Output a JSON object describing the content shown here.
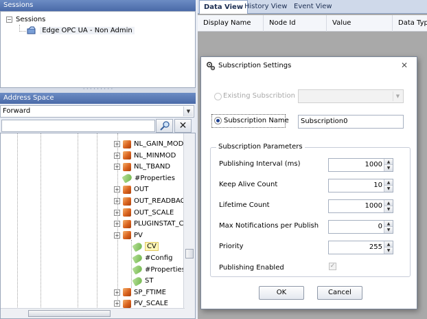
{
  "sessions_pane": {
    "title": "Sessions",
    "root_label": "Sessions",
    "session_label": "Edge OPC UA - Non Admin"
  },
  "address_space": {
    "title": "Address Space",
    "view_mode": "Forward",
    "search_value": "",
    "nodes": [
      {
        "label": "NL_GAIN_MOD",
        "icon": "object-cube-icon",
        "expandable": true,
        "selected": false
      },
      {
        "label": "NL_MINMOD",
        "icon": "object-cube-icon",
        "expandable": true,
        "selected": false
      },
      {
        "label": "NL_TBAND",
        "icon": "object-cube-icon",
        "expandable": true,
        "selected": false
      },
      {
        "label": "#Properties",
        "icon": "property-tag-icon",
        "expandable": false,
        "selected": false
      },
      {
        "label": "OUT",
        "icon": "object-cube-icon",
        "expandable": true,
        "selected": false
      },
      {
        "label": "OUT_READBAC",
        "icon": "object-cube-icon",
        "expandable": true,
        "selected": false
      },
      {
        "label": "OUT_SCALE",
        "icon": "object-cube-icon",
        "expandable": true,
        "selected": false
      },
      {
        "label": "PLUGINSTAT_C",
        "icon": "object-cube-icon",
        "expandable": true,
        "selected": false
      },
      {
        "label": "PV",
        "icon": "object-cube-icon",
        "expandable": true,
        "selected": false
      },
      {
        "label": "CV",
        "icon": "property-tag-icon",
        "expandable": false,
        "selected": true
      },
      {
        "label": "#Config",
        "icon": "property-tag-icon",
        "expandable": false,
        "selected": false
      },
      {
        "label": "#Properties",
        "icon": "property-tag-icon",
        "expandable": false,
        "selected": false
      },
      {
        "label": "ST",
        "icon": "property-tag-icon",
        "expandable": false,
        "selected": false
      },
      {
        "label": "SP_FTIME",
        "icon": "object-cube-icon",
        "expandable": true,
        "selected": false
      },
      {
        "label": "PV_SCALE",
        "icon": "object-cube-icon",
        "expandable": true,
        "selected": false
      }
    ]
  },
  "doc_tabs": [
    {
      "label": "Data View",
      "active": true
    },
    {
      "label": "History View",
      "active": false
    },
    {
      "label": "Event View",
      "active": false
    }
  ],
  "grid_columns": [
    "Display Name",
    "Node Id",
    "Value",
    "Data Typ"
  ],
  "dialog": {
    "title": "Subscription Settings",
    "existing_label": "Existing Subscribtion",
    "existing_value": "",
    "name_label": "Subscription Name",
    "name_value": "Subscription0",
    "group_title": "Subscription Parameters",
    "params": [
      {
        "label": "Publishing Interval (ms)",
        "value": "1000"
      },
      {
        "label": "Keep Alive Count",
        "value": "10"
      },
      {
        "label": "Lifetime Count",
        "value": "1000"
      },
      {
        "label": "Max Notifications per Publish",
        "value": "0"
      },
      {
        "label": "Priority",
        "value": "255"
      }
    ],
    "publishing_enabled_label": "Publishing Enabled",
    "publishing_enabled": true,
    "ok_label": "OK",
    "cancel_label": "Cancel"
  }
}
